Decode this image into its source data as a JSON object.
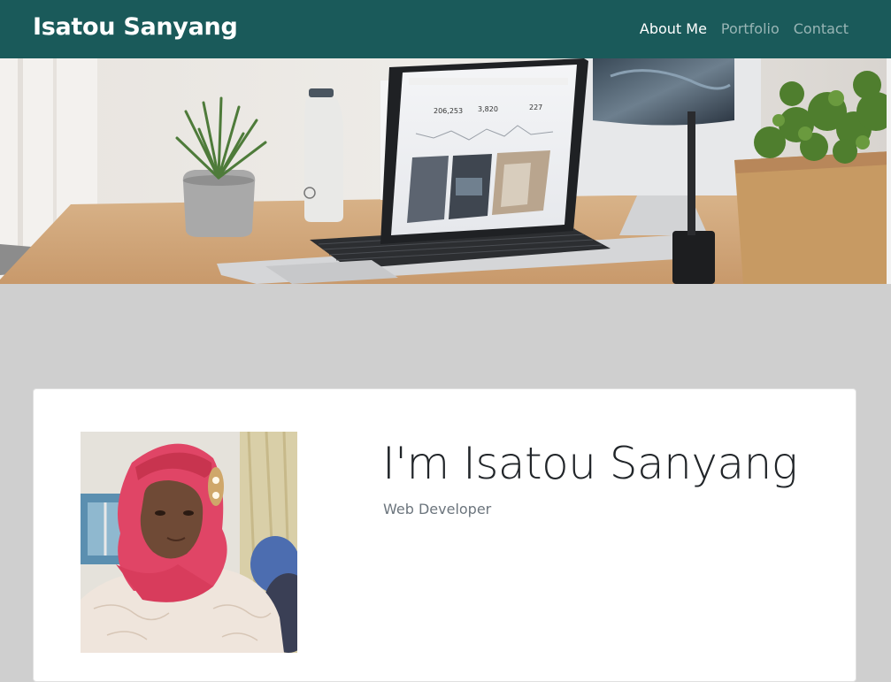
{
  "colors": {
    "nav_bg": "#1a5a5a",
    "page_bg": "#cfcfcf"
  },
  "navbar": {
    "brand": "Isatou Sanyang",
    "links": [
      {
        "label": "About Me",
        "active": true
      },
      {
        "label": "Portfolio",
        "active": false
      },
      {
        "label": "Contact",
        "active": false
      }
    ]
  },
  "hero": {
    "dashboard_stats": [
      "206,253",
      "3,820",
      "227"
    ]
  },
  "about": {
    "headline": "I'm Isatou Sanyang",
    "subtitle": "Web Developer"
  }
}
